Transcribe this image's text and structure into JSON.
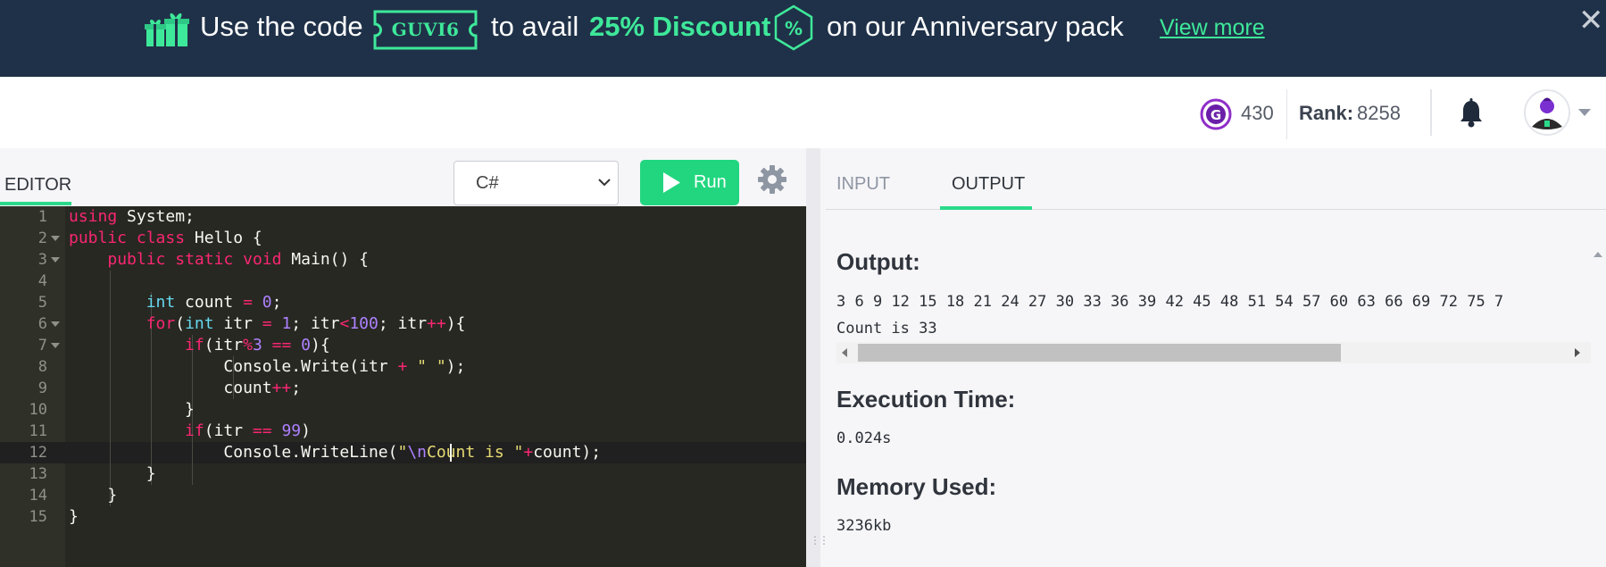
{
  "banner": {
    "text_before_code": "Use the code",
    "promo_code": "GUVI6",
    "text_middle": "to avail",
    "discount": "25% Discount",
    "text_after": "on our Anniversary pack",
    "view_more": "View more",
    "close_symbol": "✕",
    "icons": [
      "gift-icon",
      "percent-badge-icon",
      "close-icon"
    ],
    "colors": {
      "background": "#1f3148",
      "accent": "#3ee89a"
    }
  },
  "header": {
    "coins": "430",
    "rank_label": "Rank:",
    "rank_value": "8258",
    "icons": [
      "guvi-coin-icon",
      "bell-icon",
      "avatar",
      "chevron-down-icon"
    ]
  },
  "editor": {
    "tab_label": "EDITOR",
    "language": "C#",
    "run_label": "Run",
    "icons": [
      "play-icon",
      "gear-icon",
      "chevron-down-icon"
    ],
    "colors": {
      "run_button": "#22d67f",
      "background": "#272822"
    },
    "line_numbers": [
      "1",
      "2",
      "3",
      "4",
      "5",
      "6",
      "7",
      "8",
      "9",
      "10",
      "11",
      "12",
      "13",
      "14",
      "15"
    ],
    "code_lines": [
      "using System;",
      "public class Hello {",
      "    public static void Main() {",
      "",
      "        int count = 0;",
      "        for(int itr = 1; itr<100; itr++){",
      "            if(itr%3 == 0){",
      "                Console.Write(itr + \" \");",
      "                count++;",
      "            }",
      "            if(itr == 99)",
      "                Console.WriteLine(\"\\nCount is \"+count);",
      "        }",
      "    }",
      "}"
    ]
  },
  "output_panel": {
    "tab_input": "INPUT",
    "tab_output": "OUTPUT",
    "output_title": "Output:",
    "output_line1": "3 6 9 12 15 18 21 24 27 30 33 36 39 42 45 48 51 54 57 60 63 66 69 72 75 7",
    "output_line2": "Count is 33",
    "exec_title": "Execution Time:",
    "exec_value": "0.024s",
    "memory_title": "Memory Used:",
    "memory_value": "3236kb",
    "colors": {
      "active_tab": "#2ad98a"
    }
  }
}
